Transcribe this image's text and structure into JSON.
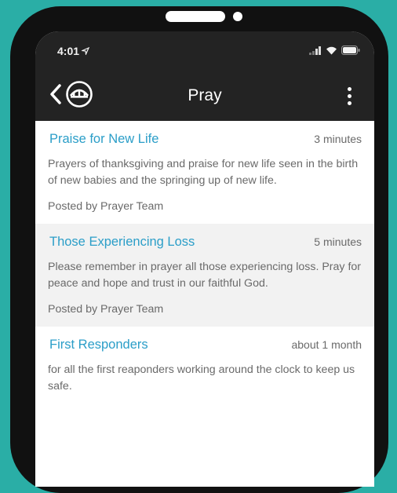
{
  "status_bar": {
    "time": "4:01",
    "location_icon": "location-arrow-icon",
    "signal_icon": "cellular-signal-icon",
    "wifi_icon": "wifi-icon",
    "battery_icon": "battery-icon"
  },
  "nav": {
    "title": "Pray",
    "back_icon": "chevron-left-icon",
    "logo_icon": "church-logo-icon",
    "menu_icon": "more-vertical-icon"
  },
  "colors": {
    "background": "#2aaea6",
    "bar": "#232323",
    "link": "#2b9ec8",
    "text": "#6a6a6a",
    "alt_row": "#f2f2f2"
  },
  "prayers": [
    {
      "title": "Praise for New Life",
      "time": "3 minutes",
      "body": "Prayers of thanksgiving and praise for new life seen in the birth of new babies and the springing up of new life.",
      "author": "Posted by Prayer Team"
    },
    {
      "title": "Those Experiencing Loss",
      "time": "5 minutes",
      "body": "Please remember in prayer all those experiencing loss. Pray for peace and hope and trust in our faithful God.",
      "author": "Posted by Prayer Team"
    },
    {
      "title": "First Responders",
      "time": "about 1 month",
      "body": "for all the first reaponders working around the clock to keep us safe.",
      "author": ""
    }
  ]
}
